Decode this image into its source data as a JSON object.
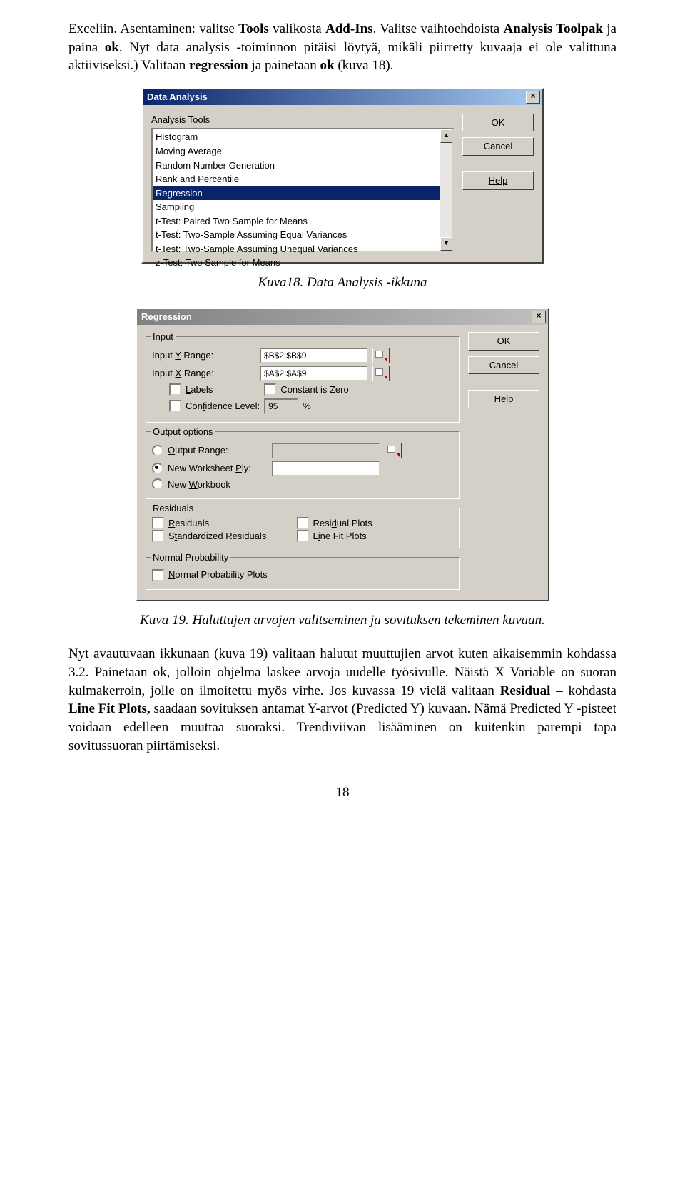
{
  "para1_a": "Exceliin. Asentaminen: valitse ",
  "para1_b": "Tools",
  "para1_c": " valikosta ",
  "para1_d": "Add-Ins",
  "para1_e": ". Valitse vaihtoehdoista ",
  "para1_f": "Analysis Toolpak",
  "para1_g": " ja paina ",
  "para1_h": "ok",
  "para1_i": ". Nyt data analysis -toiminnon pitäisi löytyä, mikäli piirretty kuvaaja ei ole valittuna aktiiviseksi.) Valitaan ",
  "para1_j": "regression",
  "para1_k": " ja painetaan ",
  "para1_l": "ok",
  "para1_m": " (kuva 18).",
  "caption1": "Kuva18. Data Analysis -ikkuna",
  "caption2": "Kuva 19. Haluttujen arvojen valitseminen ja sovituksen tekeminen kuvaan.",
  "para2_a": "Nyt avautuvaan ikkunaan (kuva 19) valitaan halutut muuttujien arvot kuten aikaisemmin kohdassa 3.2. Painetaan ok, jolloin ohjelma laskee arvoja uudelle työsivulle. Näistä X Variable on suoran kulmakerroin, jolle on ilmoitettu myös virhe. Jos kuvassa 19 vielä valitaan ",
  "para2_b": "Residual",
  "para2_c": " – kohdasta ",
  "para2_d": "Line Fit Plots,",
  "para2_e": " saadaan sovituksen antamat Y-arvot (Predicted Y) kuvaan. Nämä Predicted Y -pisteet voidaan edelleen muuttaa suoraksi. Trendiviivan lisääminen on kuitenkin parempi tapa sovitussuoran piirtämiseksi.",
  "pagenum": "18",
  "dlg1": {
    "title": "Data Analysis",
    "groupLabel": "Analysis Tools",
    "items": [
      "Histogram",
      "Moving Average",
      "Random Number Generation",
      "Rank and Percentile",
      "Regression",
      "Sampling",
      "t-Test: Paired Two Sample for Means",
      "t-Test: Two-Sample Assuming Equal Variances",
      "t-Test: Two-Sample Assuming Unequal Variances",
      "z-Test: Two Sample for Means"
    ],
    "selectedIndex": 4,
    "ok": "OK",
    "cancel": "Cancel",
    "help": "Help",
    "scrollUp": "▲",
    "scrollDown": "▼",
    "close": "×"
  },
  "dlg2": {
    "title": "Regression",
    "close": "×",
    "inputGroup": "Input",
    "inputY": "Input Y Range:",
    "inputYVal": "$B$2:$B$9",
    "inputX": "Input X Range:",
    "inputXVal": "$A$2:$A$9",
    "labels": "Labels",
    "constZero": "Constant is Zero",
    "conf": "Confidence Level:",
    "confVal": "95",
    "pct": "%",
    "outputGroup": "Output options",
    "outRange": "Output Range:",
    "newPly": "New Worksheet Ply:",
    "newWb": "New Workbook",
    "residGroup": "Residuals",
    "resid": "Residuals",
    "residPlots": "Residual Plots",
    "stdResid": "Standardized Residuals",
    "lineFit": "Line Fit Plots",
    "normGroup": "Normal Probability",
    "normPlots": "Normal Probability Plots",
    "ok": "OK",
    "cancel": "Cancel",
    "help": "Help"
  }
}
